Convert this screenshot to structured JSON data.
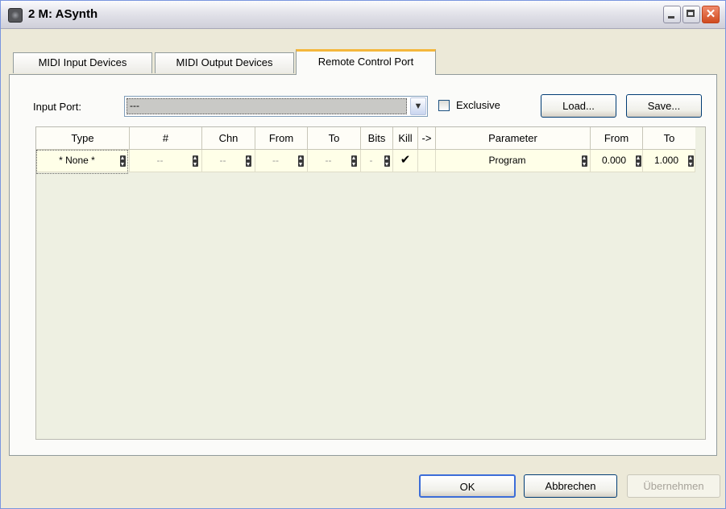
{
  "window": {
    "title": "2 M: ASynth"
  },
  "tabs": [
    {
      "label": "MIDI Input Devices"
    },
    {
      "label": "MIDI Output Devices"
    },
    {
      "label": "Remote Control Port",
      "active": true
    }
  ],
  "input_port": {
    "label": "Input Port:",
    "value": "---",
    "exclusive_label": "Exclusive",
    "exclusive_checked": false
  },
  "buttons": {
    "load": "Load...",
    "save": "Save...",
    "ok": "OK",
    "cancel": "Abbrechen",
    "apply": "Übernehmen"
  },
  "grid": {
    "headers": [
      "Type",
      "#",
      "Chn",
      "From",
      "To",
      "Bits",
      "Kill",
      "->",
      "Parameter",
      "From",
      "To"
    ],
    "rows": [
      {
        "type": "* None *",
        "number": "--",
        "chn": "--",
        "from": "--",
        "to": "--",
        "bits": "-",
        "kill": "✔",
        "arrow": "",
        "parameter": "Program",
        "pfrom": "0.000",
        "pto": "1.000"
      }
    ]
  },
  "colors": {
    "window_bg": "#ece9d8",
    "grid_bg": "#eef0e2",
    "row_bg": "#ffffe8",
    "active_tab_accent": "#f4b73c"
  },
  "icons": {
    "app": "synth-app-icon",
    "minimize": "minimize-icon",
    "maximize": "maximize-icon",
    "close": "close-icon"
  }
}
